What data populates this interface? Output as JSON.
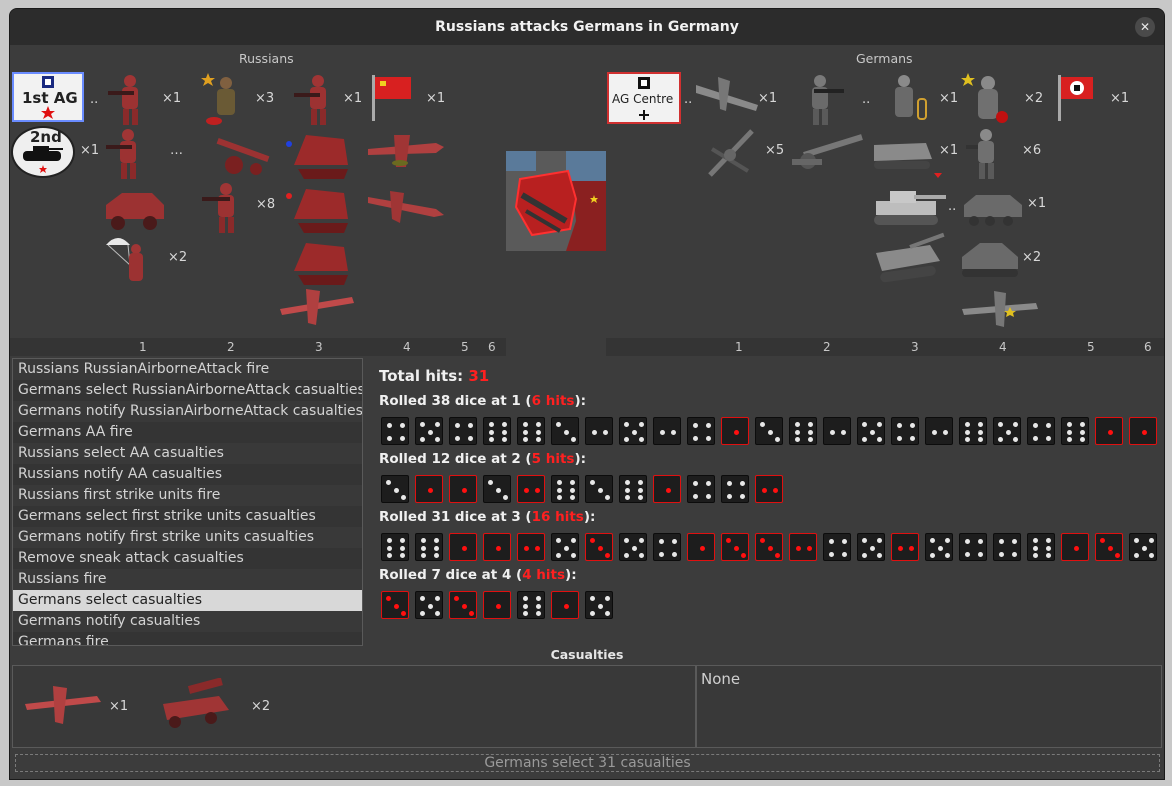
{
  "window": {
    "title": "Russians attacks Germans in Germany",
    "close_label": "✕"
  },
  "attacker": {
    "name": "Russians",
    "command_badge": "1st AG",
    "tank_badge": "2nd",
    "counts": {
      "tank_badge": "×1",
      "infantry": "×1",
      "officer": "×3",
      "assault": "×1",
      "flag": "×1",
      "artillery_ellipsis": "…",
      "soldiers": "×8",
      "airborne": "×2",
      "badge_ellipsis": ".."
    },
    "columns": [
      "1",
      "2",
      "3",
      "4",
      "5",
      "6"
    ]
  },
  "defender": {
    "name": "Germans",
    "command_badge": "AG Centre",
    "counts": {
      "fighter": "×1",
      "infantry_ellipsis": "..",
      "officer": "×1",
      "elite": "×2",
      "flag": "×1",
      "flak": "×5",
      "halftrack": "×1",
      "grenadier": "×6",
      "tiger_ellipsis": "..",
      "armored_car": "×1",
      "panzer": "×2",
      "badge_ellipsis": ".."
    },
    "columns": [
      "1",
      "2",
      "3",
      "4",
      "5",
      "6"
    ]
  },
  "battle_log": [
    "Russians RussianAirborneAttack fire",
    "Germans select RussianAirborneAttack casualties",
    "Germans notify RussianAirborneAttack casualties",
    "Germans AA fire",
    "Russians select AA casualties",
    "Russians notify AA casualties",
    "Russians first strike units fire",
    "Germans select first strike units casualties",
    "Germans notify first strike units casualties",
    "Remove sneak attack casualties",
    "Russians fire",
    "Germans select casualties",
    "Germans notify casualties",
    "Germans fire"
  ],
  "battle_log_selected": 11,
  "dice": {
    "total_label": "Total hits:",
    "total_hits": "31",
    "rolls": [
      {
        "prefix": "Rolled 38 dice at 1 (",
        "hits": "6 hits",
        "suffix": "):",
        "values": [
          4,
          5,
          4,
          6,
          6,
          3,
          2,
          5,
          2,
          4,
          1,
          3,
          6,
          2,
          5,
          4,
          2,
          6,
          5,
          4,
          6,
          1,
          1
        ]
      },
      {
        "prefix": "Rolled 12 dice at 2 (",
        "hits": "5 hits",
        "suffix": "):",
        "values": [
          3,
          1,
          1,
          3,
          2,
          6,
          3,
          6,
          1,
          4,
          4,
          2
        ]
      },
      {
        "prefix": "Rolled 31 dice at 3 (",
        "hits": "16 hits",
        "suffix": "):",
        "values": [
          6,
          6,
          1,
          1,
          2,
          5,
          3,
          5,
          4,
          1,
          3,
          3,
          2,
          4,
          5,
          2,
          5,
          4,
          4,
          6,
          1,
          3,
          5
        ]
      },
      {
        "prefix": "Rolled 7 dice at 4 (",
        "hits": "4 hits",
        "suffix": "):",
        "values": [
          3,
          5,
          3,
          1,
          6,
          1,
          5
        ]
      }
    ]
  },
  "casualties": {
    "title": "Casualties",
    "attacker_units": [
      {
        "icon": "fighter-plane-icon",
        "count": "×1"
      },
      {
        "icon": "aa-truck-icon",
        "count": "×2"
      }
    ],
    "defender_text": "None"
  },
  "status": {
    "button_label": "Germans select 31 casualties"
  },
  "colors": {
    "russian_red": "#b03030",
    "hit_red": "#ff1010",
    "german_grey": "#8a8a8a",
    "window_bg": "#3c3c3c"
  }
}
